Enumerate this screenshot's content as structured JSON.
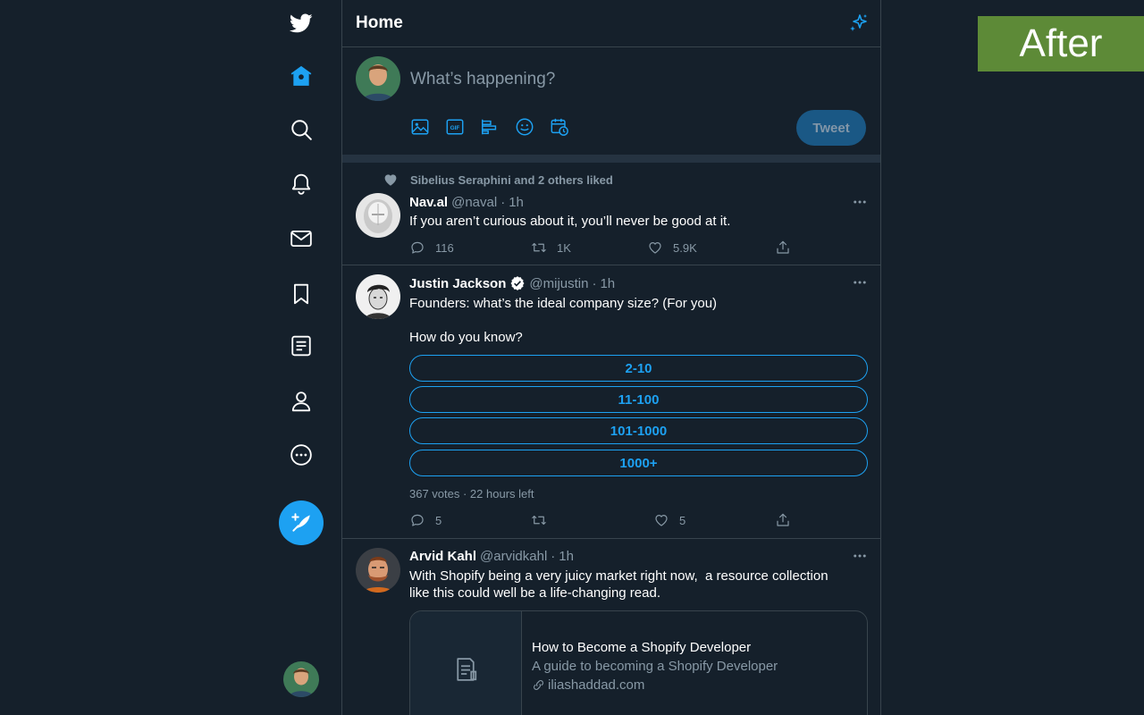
{
  "colors": {
    "background": "#15202b",
    "accent": "#1da1f2",
    "border": "#38444d",
    "muted": "#8899a6",
    "badge": "#5d8a37"
  },
  "sidebar": {
    "items": [
      {
        "name": "twitter-logo-icon"
      },
      {
        "name": "home-icon"
      },
      {
        "name": "explore-search-icon"
      },
      {
        "name": "notifications-bell-icon"
      },
      {
        "name": "messages-envelope-icon"
      },
      {
        "name": "bookmarks-icon"
      },
      {
        "name": "lists-icon"
      },
      {
        "name": "profile-icon"
      },
      {
        "name": "more-circle-icon"
      }
    ],
    "compose_icon": "feather-plus-icon"
  },
  "header": {
    "title": "Home",
    "icon": "sparkle-icon"
  },
  "composer": {
    "placeholder": "What’s happening?",
    "tools": [
      "image-icon",
      "gif-icon",
      "poll-icon",
      "emoji-icon",
      "schedule-icon"
    ],
    "gif_label": "GIF",
    "tweet_label": "Tweet"
  },
  "tweets": [
    {
      "social_context": "Sibelius Seraphini and 2 others liked",
      "name": "Nav.al",
      "handle": "@naval",
      "dot": "·",
      "time": "1h",
      "text": "If you aren’t curious about it, you’ll never be good at it.",
      "replies": "116",
      "retweets": "1K",
      "likes": "5.9K"
    },
    {
      "name": "Justin Jackson",
      "verified": true,
      "handle": "@mijustin",
      "dot": "·",
      "time": "1h",
      "text_line1": "Founders: what’s the ideal company size? (For you)",
      "text_line2": "How do you know?",
      "poll_options": [
        "2-10",
        "11-100",
        "101-1000",
        "1000+"
      ],
      "poll_meta": "367 votes · 22 hours left",
      "replies": "5",
      "retweets": "",
      "likes": "5"
    },
    {
      "name": "Arvid Kahl",
      "handle": "@arvidkahl",
      "dot": "·",
      "time": "1h",
      "text_line1": "With Shopify being a very juicy market right now,  a resource collection",
      "text_line2": "like this could well be a life-changing read.",
      "card": {
        "title": "How to Become a Shopify Developer",
        "description": "A guide to becoming a Shopify Developer",
        "domain": "iliashaddad.com"
      }
    }
  ],
  "badge": {
    "label": "After"
  }
}
